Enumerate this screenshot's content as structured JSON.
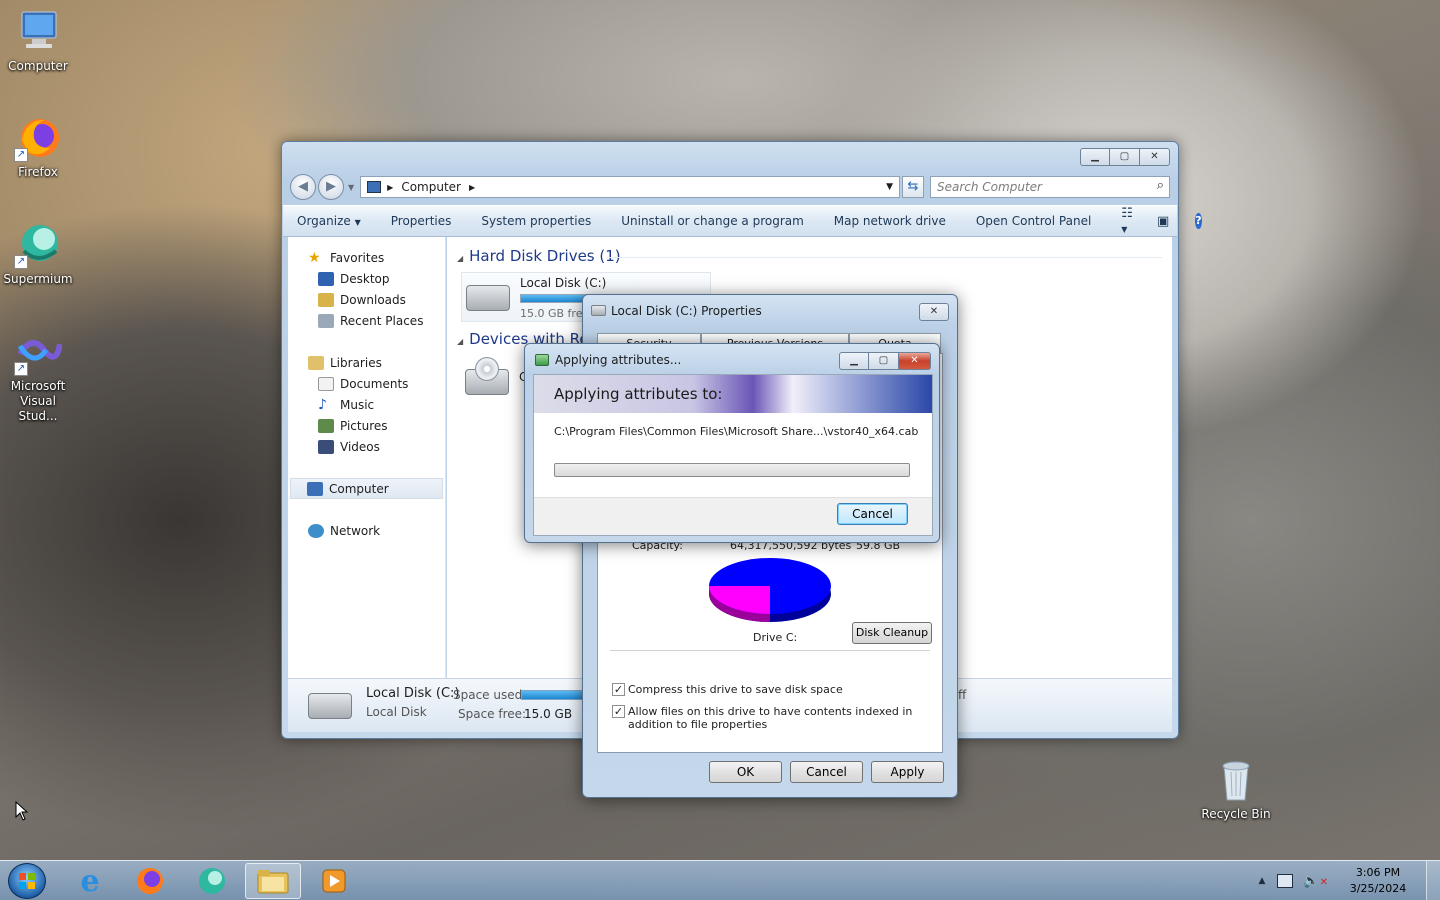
{
  "desktop": {
    "icons": [
      {
        "label": "Computer"
      },
      {
        "label": "Firefox"
      },
      {
        "label": "Supermium"
      },
      {
        "label": "Microsoft Visual Stud..."
      },
      {
        "label": "Recycle Bin"
      }
    ]
  },
  "explorer": {
    "address_path": "Computer",
    "search_placeholder": "Search Computer",
    "commands": [
      "Organize",
      "Properties",
      "System properties",
      "Uninstall or change a program",
      "Map network drive",
      "Open Control Panel"
    ],
    "nav": {
      "favorites": "Favorites",
      "favorites_items": [
        "Desktop",
        "Downloads",
        "Recent Places"
      ],
      "libraries": "Libraries",
      "libraries_items": [
        "Documents",
        "Music",
        "Pictures",
        "Videos"
      ],
      "computer": "Computer",
      "network": "Network"
    },
    "groups": {
      "hard_disks": "Hard Disk Drives (1)",
      "removable": "Devices with Rem"
    },
    "drive": {
      "name": "Local Disk (C:)",
      "free_text": "15.0 GB free",
      "used_fraction": 0.75,
      "removable_label": "C"
    },
    "details": {
      "name": "Local Disk (C:)",
      "type": "Local Disk",
      "space_used_label": "Space used:",
      "space_free_label": "Space free:",
      "space_free_value": "15.0 GB",
      "trailing": "ff"
    }
  },
  "properties_dialog": {
    "title": "Local Disk (C:) Properties",
    "tabs": [
      "Security",
      "Previous Versions",
      "Quota"
    ],
    "capacity_label": "Capacity:",
    "capacity_bytes": "64,317,550,592 bytes",
    "capacity_gb": "59.8 GB",
    "drive_label": "Drive C:",
    "used_fraction": 0.75,
    "used_color": "#0000ff",
    "free_color": "#ff00ff",
    "disk_cleanup": "Disk Cleanup",
    "compress_label": "Compress this drive to save disk space",
    "index_label": "Allow files on this drive to have contents indexed in addition to file properties",
    "compress_checked": true,
    "index_checked": true,
    "ok": "OK",
    "cancel": "Cancel",
    "apply": "Apply"
  },
  "applying_dialog": {
    "title": "Applying attributes...",
    "heading": "Applying attributes to:",
    "path": "C:\\Program Files\\Common Files\\Microsoft Share...\\vstor40_x64.cab",
    "progress": 0,
    "cancel": "Cancel"
  },
  "taskbar": {
    "time": "3:06 PM",
    "date": "3/25/2024"
  }
}
